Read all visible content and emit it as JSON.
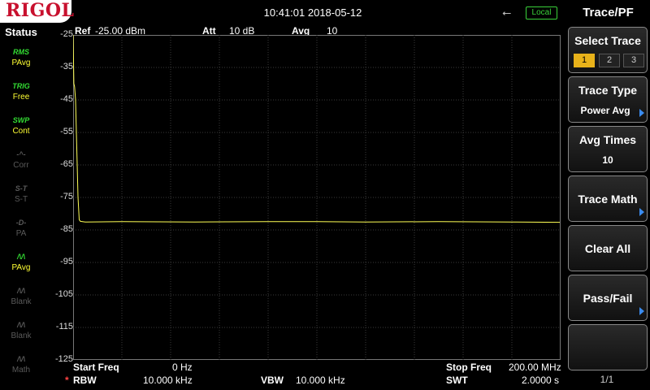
{
  "brand": "RIGOL",
  "datetime": "10:41:01 2018-05-12",
  "usb_icon": "usb-icon",
  "remote_badge": "Local",
  "status": {
    "title": "Status",
    "items": [
      {
        "icon": "RMS",
        "label": "PAvg",
        "state": "on"
      },
      {
        "icon": "TRIG",
        "label": "Free",
        "state": "on"
      },
      {
        "icon": "SWP",
        "label": "Cont",
        "state": "on"
      },
      {
        "icon": "-^-",
        "label": "Corr",
        "state": "off"
      },
      {
        "icon": "S-T",
        "label": "S-T",
        "state": "off"
      },
      {
        "icon": "-D-",
        "label": "PA",
        "state": "off"
      },
      {
        "icon": "/\\/\\",
        "label": "PAvg",
        "state": "on"
      },
      {
        "icon": "/\\/\\",
        "label": "Blank",
        "state": "off"
      },
      {
        "icon": "/\\/\\",
        "label": "Blank",
        "state": "off"
      },
      {
        "icon": "/\\/\\",
        "label": "Math",
        "state": "off"
      }
    ]
  },
  "header": {
    "ref_label": "Ref",
    "ref_value": "-25.00 dBm",
    "att_label": "Att",
    "att_value": "10 dB",
    "avg_label": "Avg",
    "avg_value": "10"
  },
  "footer": {
    "start_label": "Start Freq",
    "start_value": "0 Hz",
    "stop_label": "Stop Freq",
    "stop_value": "200.00 MHz",
    "rbw_marker": "*",
    "rbw_label": "RBW",
    "rbw_value": "10.000 kHz",
    "vbw_label": "VBW",
    "vbw_value": "10.000 kHz",
    "swt_label": "SWT",
    "swt_value": "2.0000 s"
  },
  "menu": {
    "title": "Trace/PF",
    "select_trace": {
      "label": "Select Trace",
      "options": [
        "1",
        "2",
        "3"
      ],
      "selected": "1"
    },
    "trace_type": {
      "label": "Trace Type",
      "value": "Power Avg"
    },
    "avg_times": {
      "label": "Avg Times",
      "value": "10"
    },
    "trace_math": {
      "label": "Trace Math"
    },
    "clear_all": {
      "label": "Clear All"
    },
    "pass_fail": {
      "label": "Pass/Fail"
    },
    "page": "1/1"
  },
  "colors": {
    "trace": "#ffff55",
    "accent": "#e8b21a",
    "status_on": "#33dd33",
    "status_label": "#ffff33",
    "arrow": "#3a8cf0"
  },
  "chart_data": {
    "type": "line",
    "xlabel": "",
    "ylabel": "",
    "x_unit": "MHz",
    "y_unit": "dBm",
    "xlim": [
      0,
      200
    ],
    "ylim": [
      -125,
      -25
    ],
    "y_ticks": [
      "-25",
      "-35",
      "-45",
      "-55",
      "-65",
      "-75",
      "-85",
      "-95",
      "-105",
      "-115",
      "-125"
    ],
    "grid": true,
    "series": [
      {
        "x": [
          0,
          0.3,
          0.6,
          1.0,
          1.5,
          2.0,
          2.5,
          3.0,
          5,
          20,
          50,
          80,
          100,
          120,
          150,
          180,
          200
        ],
        "y": [
          -25,
          -40,
          -41,
          -45,
          -60,
          -75,
          -82,
          -82.5,
          -82.7,
          -82.6,
          -82.7,
          -82.6,
          -82.6,
          -82.7,
          -82.6,
          -82.7,
          -82.8
        ]
      }
    ]
  }
}
